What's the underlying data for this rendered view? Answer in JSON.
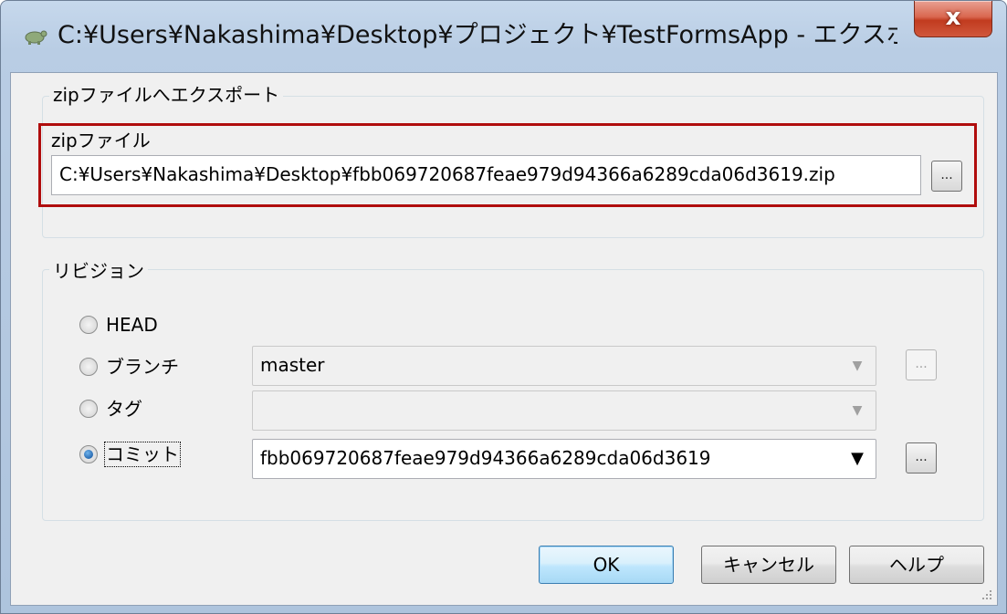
{
  "window": {
    "title": "C:¥Users¥Nakashima¥Desktop¥プロジェクト¥TestFormsApp - エクスポート - ...",
    "close_label": "x"
  },
  "export_group": {
    "legend": "zipファイルへエクスポート",
    "zip_label": "zipファイル",
    "zip_path": "C:¥Users¥Nakashima¥Desktop¥fbb069720687feae979d94366a6289cda06d3619.zip",
    "browse_label": "..."
  },
  "revision_group": {
    "legend": "リビジョン",
    "options": [
      {
        "label": "HEAD",
        "checked": false
      },
      {
        "label": "ブランチ",
        "checked": false
      },
      {
        "label": "タグ",
        "checked": false
      },
      {
        "label": "コミット",
        "checked": true
      }
    ],
    "branch_value": "master",
    "tag_value": "",
    "commit_value": "fbb069720687feae979d94366a6289cda06d3619",
    "branch_browse_label": "...",
    "commit_browse_label": "..."
  },
  "buttons": {
    "ok": "OK",
    "cancel": "キャンセル",
    "help": "ヘルプ"
  },
  "colors": {
    "highlight_border": "#b00d0d",
    "default_button_border": "#3c7fb1"
  }
}
